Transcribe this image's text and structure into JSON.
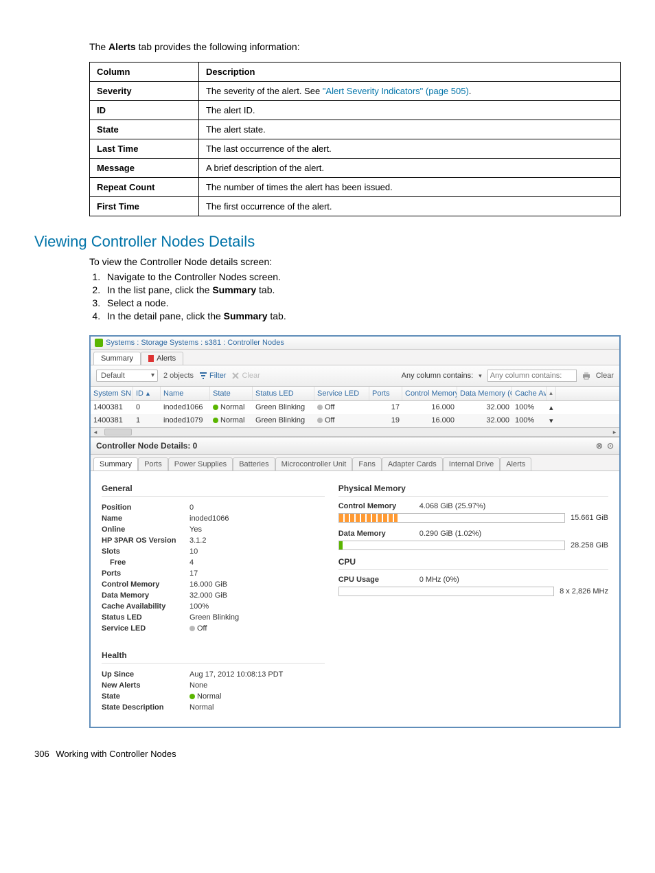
{
  "intro": {
    "pre": "The ",
    "bold": "Alerts",
    "post": " tab provides the following information:"
  },
  "defs_header": {
    "col1": "Column",
    "col2": "Description"
  },
  "defs": [
    {
      "col": "Severity",
      "desc_pre": "The severity of the alert. See ",
      "link": "\"Alert Severity Indicators\" (page 505)",
      "desc_post": "."
    },
    {
      "col": "ID",
      "desc_pre": "The alert ID.",
      "link": "",
      "desc_post": ""
    },
    {
      "col": "State",
      "desc_pre": "The alert state.",
      "link": "",
      "desc_post": ""
    },
    {
      "col": "Last Time",
      "desc_pre": "The last occurrence of the alert.",
      "link": "",
      "desc_post": ""
    },
    {
      "col": "Message",
      "desc_pre": "A brief description of the alert.",
      "link": "",
      "desc_post": ""
    },
    {
      "col": "Repeat Count",
      "desc_pre": "The number of times the alert has been issued.",
      "link": "",
      "desc_post": ""
    },
    {
      "col": "First Time",
      "desc_pre": "The first occurrence of the alert.",
      "link": "",
      "desc_post": ""
    }
  ],
  "heading": "Viewing Controller Nodes Details",
  "steps_intro": "To view the Controller Node details screen:",
  "steps": [
    {
      "pre": "Navigate to the Controller Nodes screen.",
      "bold": "",
      "post": ""
    },
    {
      "pre": "In the list pane, click the ",
      "bold": "Summary",
      "post": " tab."
    },
    {
      "pre": "Select a node.",
      "bold": "",
      "post": ""
    },
    {
      "pre": "In the detail pane, click the ",
      "bold": "Summary",
      "post": " tab."
    }
  ],
  "ui": {
    "crumb": "Systems : Storage Systems : s381 : Controller Nodes",
    "top_tabs": {
      "summary": "Summary",
      "alerts": "Alerts"
    },
    "toolbar": {
      "view": "Default",
      "count": "2 objects",
      "filter": "Filter",
      "clear": "Clear",
      "any_col": "Any column contains:",
      "clear2": "Clear"
    },
    "grid": {
      "headers": {
        "sn": "System SN",
        "id": "ID",
        "name": "Name",
        "state": "State",
        "status_led": "Status LED",
        "service_led": "Service LED",
        "ports": "Ports",
        "ctrl_mem": "Control Memory (GiB)",
        "data_mem": "Data Memory (GiB)",
        "cache": "Cache Availabili"
      },
      "rows": [
        {
          "sn": "1400381",
          "id": "0",
          "name": "inoded1066",
          "state": "Normal",
          "status_led": "Green Blinking",
          "service_led": "Off",
          "ports": "17",
          "ctrl_mem": "16.000",
          "data_mem": "32.000",
          "cache": "100%"
        },
        {
          "sn": "1400381",
          "id": "1",
          "name": "inoded1079",
          "state": "Normal",
          "status_led": "Green Blinking",
          "service_led": "Off",
          "ports": "19",
          "ctrl_mem": "16.000",
          "data_mem": "32.000",
          "cache": "100%"
        }
      ]
    },
    "detail_header": "Controller Node Details: 0",
    "detail_tabs": [
      "Summary",
      "Ports",
      "Power Supplies",
      "Batteries",
      "Microcontroller Unit",
      "Fans",
      "Adapter Cards",
      "Internal Drive",
      "Alerts"
    ],
    "general": {
      "title": "General",
      "position": {
        "k": "Position",
        "v": "0"
      },
      "name": {
        "k": "Name",
        "v": "inoded1066"
      },
      "online": {
        "k": "Online",
        "v": "Yes"
      },
      "osver": {
        "k": "HP 3PAR OS Version",
        "v": "3.1.2"
      },
      "slots": {
        "k": "Slots",
        "v": "10"
      },
      "free": {
        "k": "Free",
        "v": "4"
      },
      "ports": {
        "k": "Ports",
        "v": "17"
      },
      "ctrlmem": {
        "k": "Control Memory",
        "v": "16.000 GiB"
      },
      "datamem": {
        "k": "Data Memory",
        "v": "32.000 GiB"
      },
      "cache": {
        "k": "Cache Availability",
        "v": "100%"
      },
      "status_led": {
        "k": "Status LED",
        "v": "Green Blinking"
      },
      "service_led": {
        "k": "Service LED",
        "v": "Off"
      }
    },
    "physmem": {
      "title": "Physical Memory",
      "ctrl": {
        "k": "Control Memory",
        "v": "4.068 GiB (25.97%)",
        "total": "15.661 GiB"
      },
      "data": {
        "k": "Data Memory",
        "v": "0.290 GiB (1.02%)",
        "total": "28.258 GiB"
      }
    },
    "cpu": {
      "title": "CPU",
      "usage": {
        "k": "CPU Usage",
        "v": "0 MHz (0%)",
        "total": "8 x 2,826 MHz"
      }
    },
    "health": {
      "title": "Health",
      "upsince": {
        "k": "Up Since",
        "v": "Aug 17, 2012 10:08:13 PDT"
      },
      "newalerts": {
        "k": "New Alerts",
        "v": "None"
      },
      "state": {
        "k": "State",
        "v": "Normal"
      },
      "statedesc": {
        "k": "State Description",
        "v": "Normal"
      }
    }
  },
  "footer": {
    "page": "306",
    "title": "Working with Controller Nodes"
  },
  "chart_data": [
    {
      "type": "bar",
      "title": "Control Memory",
      "categories": [
        "used"
      ],
      "values": [
        4.068
      ],
      "ylim": [
        0,
        15.661
      ],
      "ylabel": "GiB"
    },
    {
      "type": "bar",
      "title": "Data Memory",
      "categories": [
        "used"
      ],
      "values": [
        0.29
      ],
      "ylim": [
        0,
        28.258
      ],
      "ylabel": "GiB"
    },
    {
      "type": "bar",
      "title": "CPU Usage",
      "categories": [
        "used"
      ],
      "values": [
        0
      ],
      "ylim": [
        0,
        22608
      ],
      "ylabel": "MHz"
    }
  ]
}
